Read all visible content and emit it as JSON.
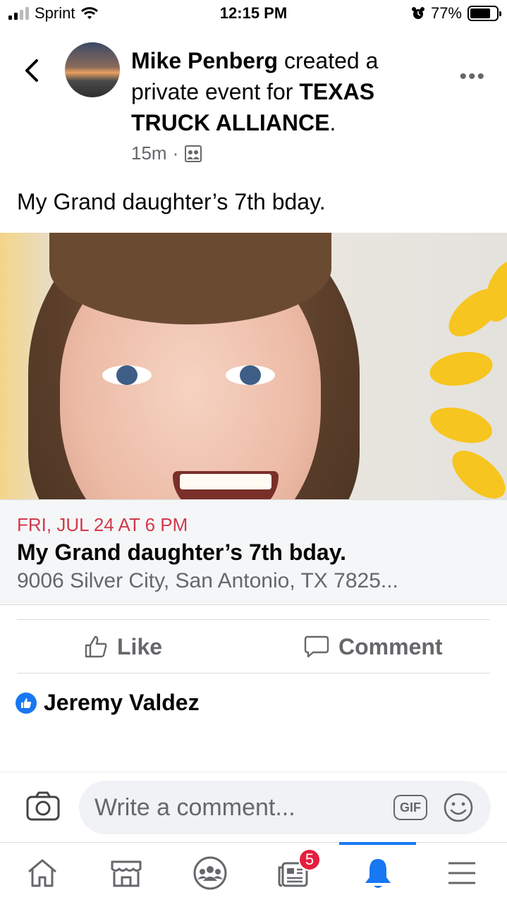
{
  "status_bar": {
    "carrier": "Sprint",
    "time": "12:15 PM",
    "battery_percent": "77%",
    "battery_level": 0.77,
    "icons": [
      "signal-icon",
      "wifi-icon",
      "alarm-icon",
      "battery-icon"
    ]
  },
  "post": {
    "author": "Mike Penberg",
    "action_text": " created a private event for ",
    "group": "TEXAS TRUCK ALLIANCE",
    "period": ".",
    "timestamp": "15m",
    "separator": "·",
    "body": "My Grand daughter’s 7th bday."
  },
  "event": {
    "date": "FRI, JUL 24 AT 6 PM",
    "title": "My Grand daughter’s 7th bday.",
    "address": "9006 Silver City, San Antonio, TX 7825..."
  },
  "actions": {
    "like_label": "Like",
    "comment_label": "Comment"
  },
  "reactions": {
    "reactor_name": "Jeremy Valdez"
  },
  "composer": {
    "placeholder": "Write a comment...",
    "gif_label": "GIF"
  },
  "tabbar": {
    "notification_count": "5",
    "active_tab": "notifications"
  },
  "colors": {
    "accent": "#1877f2",
    "event_date": "#d23a4c",
    "secondary_text": "#65676b",
    "badge": "#e41e3f"
  }
}
